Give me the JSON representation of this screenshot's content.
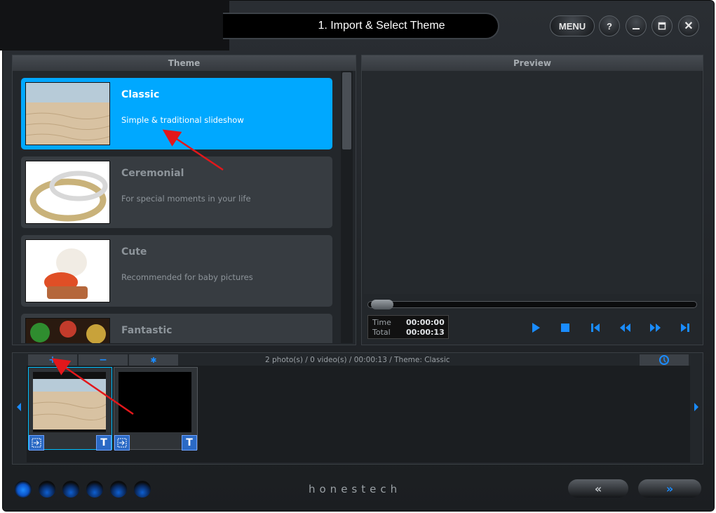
{
  "window": {
    "title": "1. Import & Select Theme",
    "menu_label": "MENU",
    "help_label": "?",
    "close_label": "✕"
  },
  "theme_panel": {
    "header": "Theme",
    "items": [
      {
        "name": "Classic",
        "description": "Simple & traditional slideshow",
        "selected": true
      },
      {
        "name": "Ceremonial",
        "description": "For special moments in your life",
        "selected": false
      },
      {
        "name": "Cute",
        "description": "Recommended for baby pictures",
        "selected": false
      },
      {
        "name": "Fantastic",
        "description": "",
        "selected": false
      }
    ]
  },
  "preview_panel": {
    "header": "Preview",
    "time_label": "Time",
    "time_value": "00:00:00",
    "total_label": "Total",
    "total_value": "00:00:13"
  },
  "timeline": {
    "add_label": "+",
    "remove_label": "−",
    "effects_label": "✱",
    "status": "2 photo(s) / 0 video(s) / 00:00:13 / Theme: Classic",
    "text_button_label": "T"
  },
  "footer": {
    "brand": "honestech",
    "back_label": "«",
    "next_label": "»"
  },
  "colors": {
    "accent": "#00a8ff",
    "control_blue": "#1a8cff"
  }
}
